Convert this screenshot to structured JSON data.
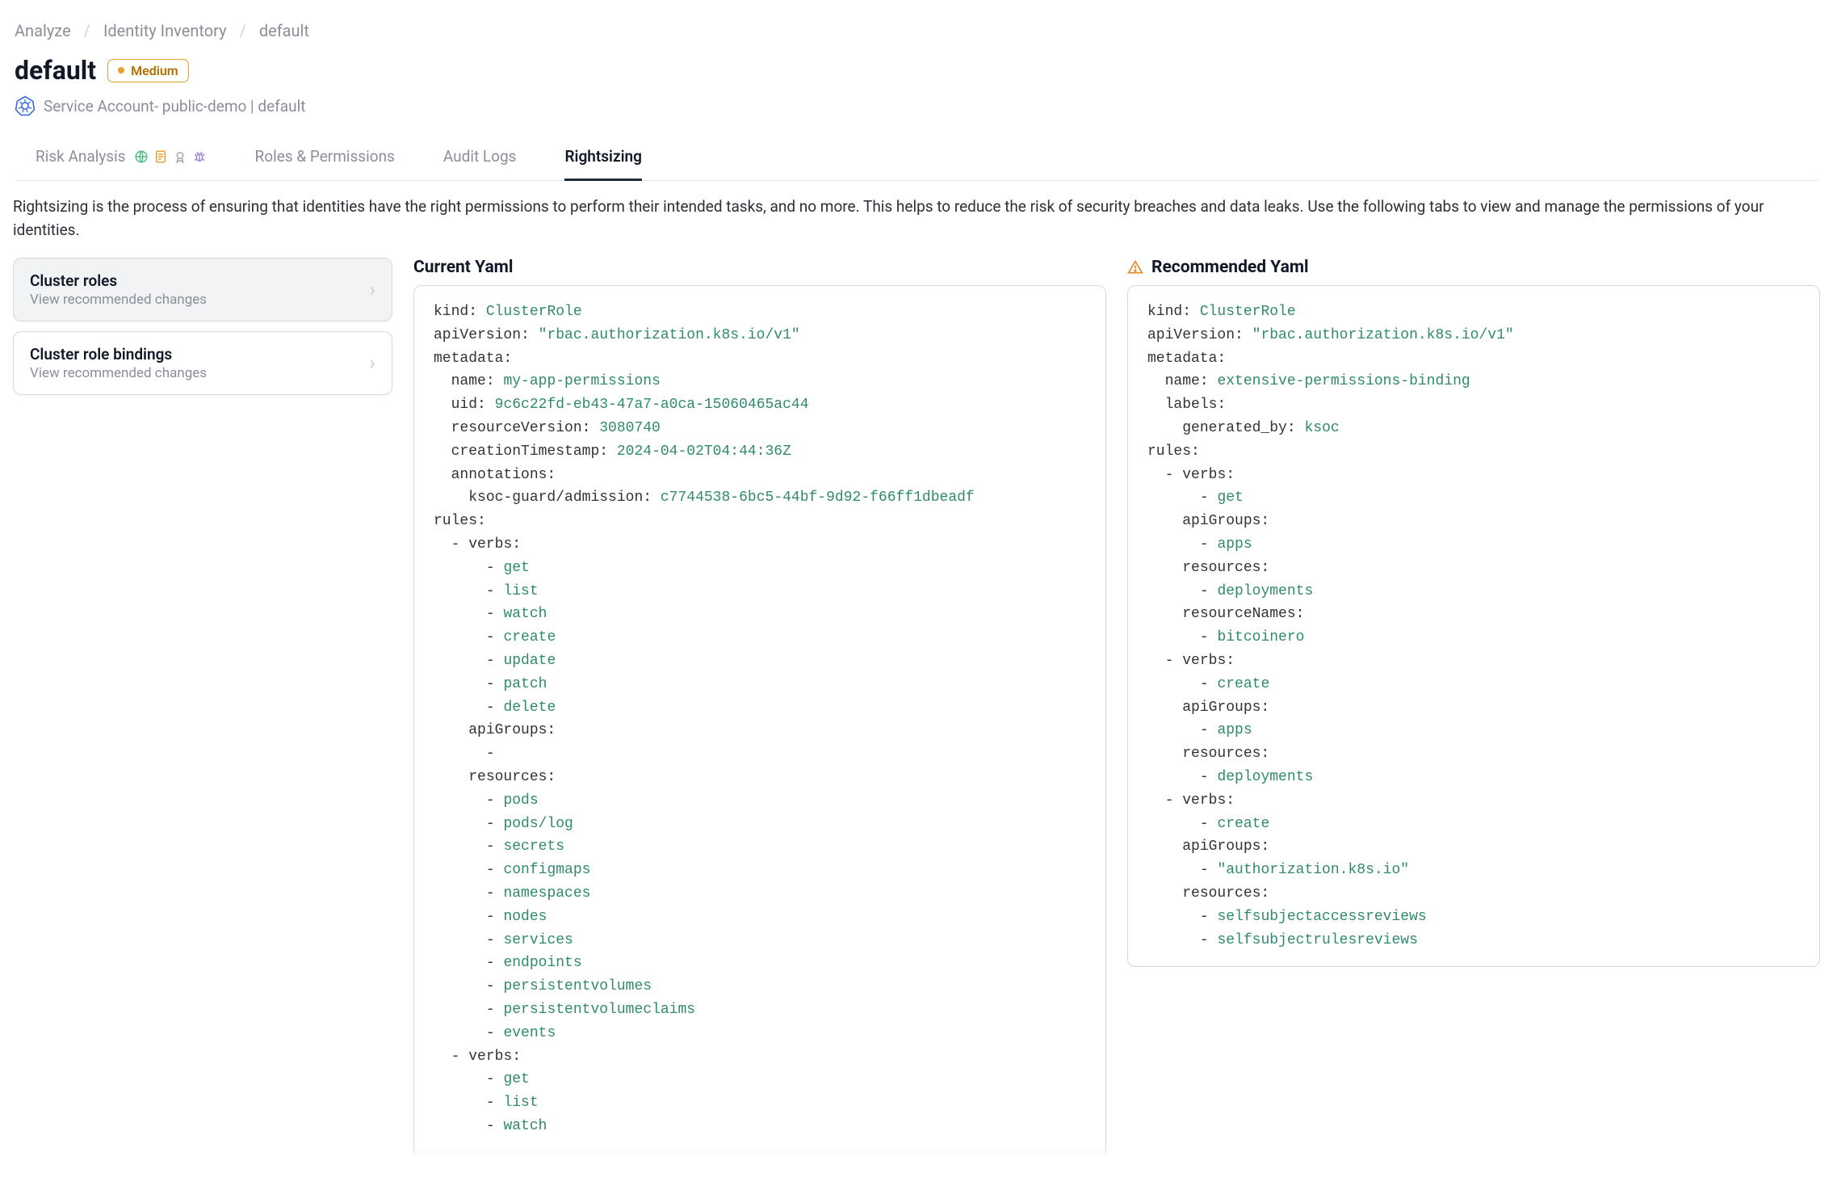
{
  "breadcrumbs": [
    "Analyze",
    "Identity Inventory",
    "default"
  ],
  "page": {
    "title": "default",
    "severity_label": "Medium",
    "subtitle": "Service Account- public-demo | default"
  },
  "tabs": [
    {
      "id": "risk",
      "label": "Risk Analysis",
      "active": false,
      "icons": [
        "globe-icon",
        "doc-icon",
        "badge-icon",
        "bug-icon"
      ]
    },
    {
      "id": "roles",
      "label": "Roles & Permissions",
      "active": false
    },
    {
      "id": "audit",
      "label": "Audit Logs",
      "active": false
    },
    {
      "id": "rightsizing",
      "label": "Rightsizing",
      "active": true
    }
  ],
  "description": "Rightsizing is the process of ensuring that identities have the right permissions to perform their intended tasks, and no more. This helps to reduce the risk of security breaches and data leaks. Use the following tabs to view and manage the permissions of your identities.",
  "side_list": [
    {
      "title": "Cluster roles",
      "subtitle": "View recommended changes",
      "active": true
    },
    {
      "title": "Cluster role bindings",
      "subtitle": "View recommended changes",
      "active": false
    }
  ],
  "yaml": {
    "current_title": "Current Yaml",
    "recommended_title": "Recommended Yaml",
    "current": {
      "kind": "ClusterRole",
      "apiVersion": "rbac.authorization.k8s.io/v1",
      "metadata": {
        "name": "my-app-permissions",
        "uid": "9c6c22fd-eb43-47a7-a0ca-15060465ac44",
        "resourceVersion": "3080740",
        "creationTimestamp": "2024-04-02T04:44:36Z",
        "annotations": {
          "ksoc-guard/admission": "c7744538-6bc5-44bf-9d92-f66ff1dbeadf"
        }
      },
      "rules": [
        {
          "verbs": [
            "get",
            "list",
            "watch",
            "create",
            "update",
            "patch",
            "delete"
          ],
          "apiGroups": [
            ""
          ],
          "resources": [
            "pods",
            "pods/log",
            "secrets",
            "configmaps",
            "namespaces",
            "nodes",
            "services",
            "endpoints",
            "persistentvolumes",
            "persistentvolumeclaims",
            "events"
          ]
        },
        {
          "verbs_partial": [
            "get",
            "list",
            "watch"
          ],
          "truncated": true
        }
      ]
    },
    "recommended": {
      "kind": "ClusterRole",
      "apiVersion": "rbac.authorization.k8s.io/v1",
      "metadata": {
        "name": "extensive-permissions-binding",
        "labels": {
          "generated_by": "ksoc"
        }
      },
      "rules": [
        {
          "verbs": [
            "get"
          ],
          "apiGroups": [
            "apps"
          ],
          "resources": [
            "deployments"
          ],
          "resourceNames": [
            "bitcoinero"
          ]
        },
        {
          "verbs": [
            "create"
          ],
          "apiGroups": [
            "apps"
          ],
          "resources": [
            "deployments"
          ]
        },
        {
          "verbs": [
            "create"
          ],
          "apiGroups": [
            "\"authorization.k8s.io\""
          ],
          "resources": [
            "selfsubjectaccessreviews",
            "selfsubjectrulesreviews"
          ]
        }
      ]
    }
  }
}
